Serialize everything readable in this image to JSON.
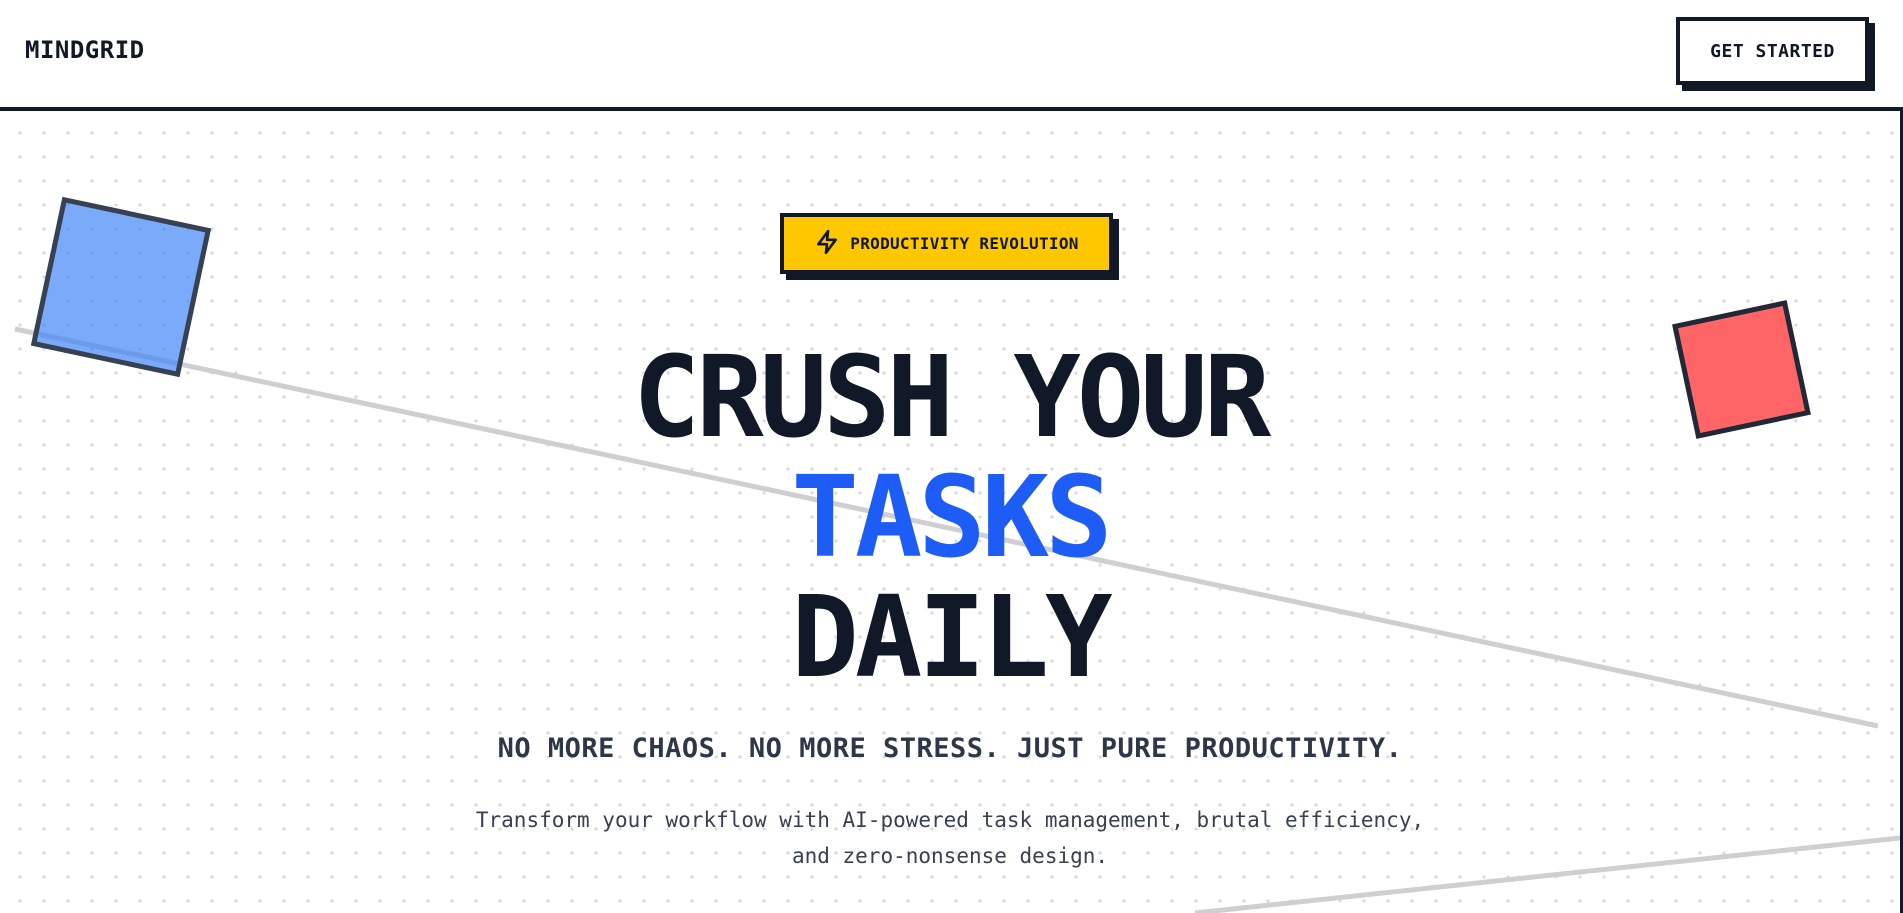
{
  "header": {
    "logo": "MINDGRID",
    "cta_label": "GET STARTED"
  },
  "hero": {
    "badge": {
      "icon": "lightning-bolt-icon",
      "label": "PRODUCTIVITY REVOLUTION"
    },
    "headline": {
      "line1": "CRUSH YOUR",
      "line2": "TASKS",
      "line3": "DAILY"
    },
    "tagline": "NO MORE CHAOS. NO MORE STRESS. JUST PURE PRODUCTIVITY.",
    "description_line1": "Transform your workflow with AI-powered task management, brutal efficiency,",
    "description_line2": "and zero-nonsense design."
  },
  "colors": {
    "ink": "#111827",
    "accent_blue": "#1d5cf5",
    "badge_yellow": "#ffc700",
    "square_blue": "#5b9dfb",
    "square_red": "#ff6566"
  }
}
